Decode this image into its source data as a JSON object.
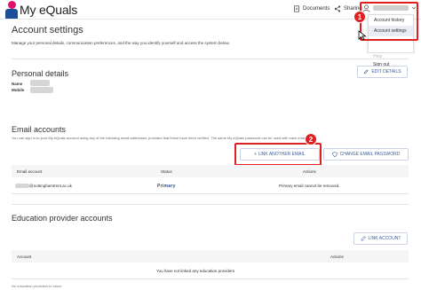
{
  "app": {
    "title": "My eQuals"
  },
  "topbar": {
    "documents_label": "Documents",
    "sharing_label": "Sharing"
  },
  "user_menu": {
    "items": [
      {
        "label": "Account history"
      },
      {
        "label": "Account settings"
      },
      {
        "label": "Help"
      },
      {
        "label": "Sign out"
      }
    ]
  },
  "callouts": {
    "one": "1",
    "two": "2"
  },
  "page": {
    "title": "Account settings",
    "intro": "Manage your personal details, communication preferences, and the way you identify yourself and access the system below."
  },
  "personal": {
    "title": "Personal details",
    "name_label": "Name",
    "mobile_label": "Mobile",
    "edit_button": "EDIT DETAILS"
  },
  "email": {
    "title": "Email accounts",
    "description": "You can sign in to your My eQuals account using any of the following email addresses, provided that these have been verified. The same My eQuals password can be used with each email...",
    "link_button": "+ LINK ANOTHER EMAIL",
    "change_password_button": "CHANGE EMAIL PASSWORD",
    "columns": [
      "Email account",
      "Status",
      "Actions"
    ],
    "rows": [
      {
        "email": "@nottinghamtrent.ac.uk",
        "status": "Primary",
        "action": "Primary email cannot be removed."
      }
    ]
  },
  "education": {
    "title": "Education provider accounts",
    "link_button": "LINK ACCOUNT",
    "columns": [
      "Account",
      "Actions"
    ],
    "empty_message": "You have not linked any education providers",
    "footer": "No education providers to show"
  },
  "colors": {
    "accent": "#3a5fa0",
    "callout": "#e02020",
    "brand_pink": "#e0116b",
    "brand_blue": "#1b4f9a"
  }
}
